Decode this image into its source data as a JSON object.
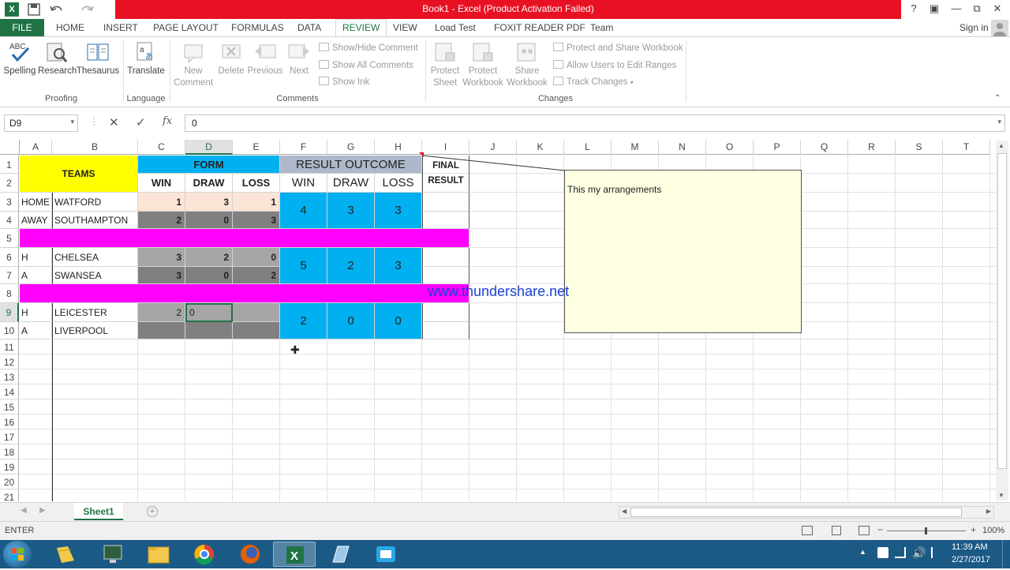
{
  "window": {
    "title": "Book1 -  Excel (Product Activation Failed)"
  },
  "ribbon_tabs": [
    "FILE",
    "HOME",
    "INSERT",
    "PAGE LAYOUT",
    "FORMULAS",
    "DATA",
    "REVIEW",
    "VIEW",
    "Load Test",
    "FOXIT READER PDF",
    "Team"
  ],
  "sign_in": "Sign in",
  "ribbon": {
    "spelling": "Spelling",
    "research": "Research",
    "thesaurus": "Thesaurus",
    "translate": "Translate",
    "new_comment": [
      "New",
      "Comment"
    ],
    "delete": "Delete",
    "previous": "Previous",
    "next": "Next",
    "show_hide_comment": "Show/Hide Comment",
    "show_all_comments": "Show All Comments",
    "show_ink": "Show Ink",
    "protect_sheet": [
      "Protect",
      "Sheet"
    ],
    "protect_workbook": [
      "Protect",
      "Workbook"
    ],
    "share_workbook": [
      "Share",
      "Workbook"
    ],
    "protect_share_workbook": "Protect and Share Workbook",
    "allow_users": "Allow Users to Edit Ranges",
    "track_changes": "Track Changes",
    "groups": {
      "proofing": "Proofing",
      "language": "Language",
      "comments": "Comments",
      "changes": "Changes"
    }
  },
  "formula_bar": {
    "name_box": "D9",
    "formula": "0"
  },
  "columns": [
    "A",
    "B",
    "C",
    "D",
    "E",
    "F",
    "G",
    "H",
    "I",
    "J",
    "K",
    "L",
    "M",
    "N",
    "O",
    "P",
    "Q",
    "R",
    "S",
    "T"
  ],
  "rows": [
    "1",
    "2",
    "3",
    "4",
    "5",
    "6",
    "7",
    "8",
    "9",
    "10",
    "11",
    "12",
    "13",
    "14",
    "15",
    "16",
    "17",
    "18",
    "19",
    "20",
    "21"
  ],
  "sheet": {
    "teams_header": "TEAMS",
    "form_header": "FORM",
    "result_header": "RESULT OUTCOME",
    "final_result": [
      "FINAL",
      "RESULT"
    ],
    "sub_headers": [
      "WIN",
      "DRAW",
      "LOSS"
    ],
    "matches": [
      {
        "home_label": "HOME",
        "away_label": "AWAY",
        "home": "WATFORD",
        "away": "SOUTHAMPTON",
        "home_form": [
          "1",
          "3",
          "1"
        ],
        "away_form": [
          "2",
          "0",
          "3"
        ],
        "result": [
          "4",
          "3",
          "3"
        ]
      },
      {
        "home_label": "H",
        "away_label": "A",
        "home": "CHELSEA",
        "away": "SWANSEA",
        "home_form": [
          "3",
          "2",
          "0"
        ],
        "away_form": [
          "3",
          "0",
          "2"
        ],
        "result": [
          "5",
          "2",
          "3"
        ]
      },
      {
        "home_label": "H",
        "away_label": "A",
        "home": "LEICESTER",
        "away": "LIVERPOOL",
        "home_form": [
          "2",
          "0",
          ""
        ],
        "away_form": [
          "",
          "",
          ""
        ],
        "result": [
          "2",
          "0",
          "0"
        ]
      }
    ]
  },
  "comment_text": "This my arrangements",
  "watermark": "www.thundershare.net",
  "sheet_tab": "Sheet1",
  "status": {
    "mode": "ENTER",
    "zoom": "100%"
  },
  "clock": {
    "time": "11:39 AM",
    "date": "2/27/2017"
  },
  "colors": {
    "excel_green": "#217346",
    "title_red": "#e81123",
    "yellow": "#ffff00",
    "form_blue": "#00b0f0",
    "result_gray": "#adb9ca",
    "magenta": "#ff00ff",
    "peach": "#fce4d6",
    "dark_gray": "#808080",
    "mid_gray": "#a6a6a6",
    "comment_bg": "#ffffe1"
  }
}
